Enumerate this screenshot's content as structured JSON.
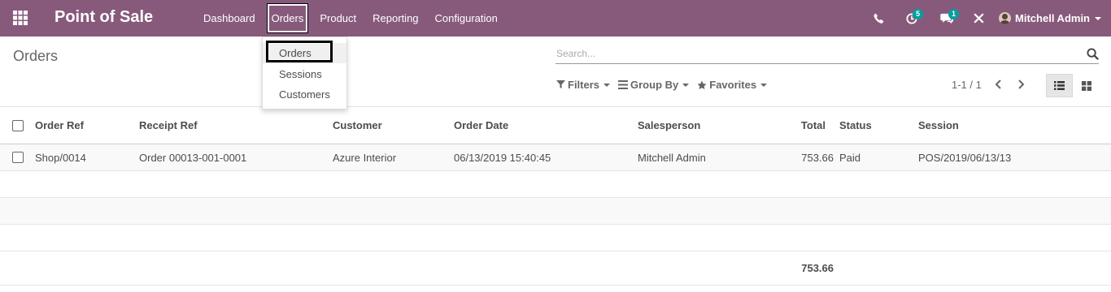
{
  "navbar": {
    "brand": "Point of Sale",
    "menu": [
      "Dashboard",
      "Orders",
      "Product",
      "Reporting",
      "Configuration"
    ],
    "activity_count": "5",
    "message_count": "1",
    "user_name": "Mitchell Admin"
  },
  "dropdown": {
    "items": [
      "Orders",
      "Sessions",
      "Customers"
    ]
  },
  "control": {
    "breadcrumb": "Orders",
    "search_placeholder": "Search...",
    "filters_label": "Filters",
    "groupby_label": "Group By",
    "favorites_label": "Favorites",
    "pager": "1-1 / 1"
  },
  "table": {
    "headers": [
      "Order Ref",
      "Receipt Ref",
      "Customer",
      "Order Date",
      "Salesperson",
      "Total",
      "Status",
      "Session"
    ],
    "rows": [
      [
        "Shop/0014",
        "Order 00013-001-0001",
        "Azure Interior",
        "06/13/2019 15:40:45",
        "Mitchell Admin",
        "753.66",
        "Paid",
        "POS/2019/06/13/13"
      ]
    ],
    "footer_total": "753.66"
  },
  "colors": {
    "navbar": "#875a7b",
    "badge": "#00a09d"
  }
}
